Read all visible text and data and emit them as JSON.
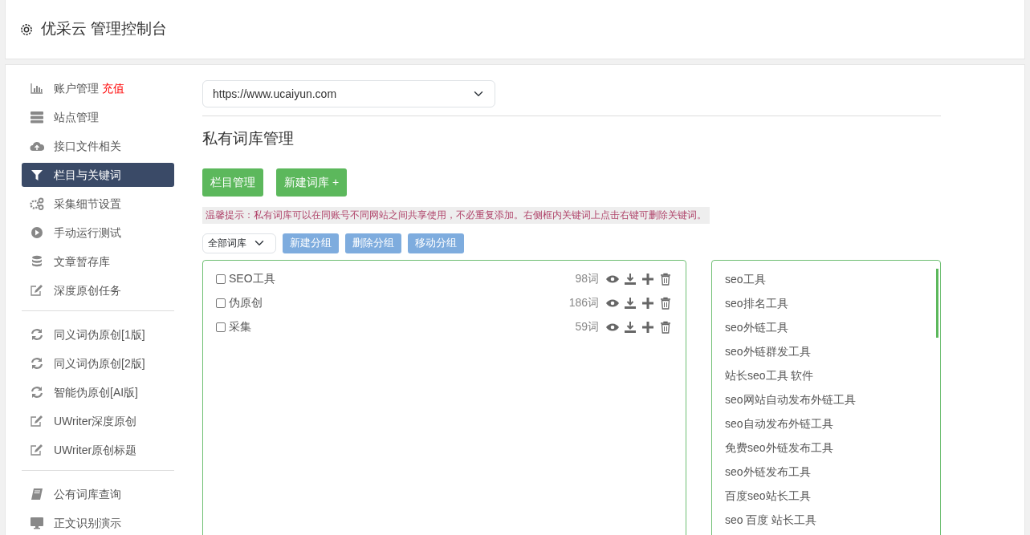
{
  "header": {
    "title": "优采云 管理控制台"
  },
  "sidebar": {
    "groups": [
      {
        "items": [
          {
            "label": "账户管理",
            "extra": "充值",
            "selected": false
          },
          {
            "label": "站点管理",
            "selected": false
          },
          {
            "label": "接口文件相关",
            "selected": false
          },
          {
            "label": "栏目与关键词",
            "selected": true
          },
          {
            "label": "采集细节设置",
            "selected": false
          },
          {
            "label": "手动运行测试",
            "selected": false
          },
          {
            "label": "文章暂存库",
            "selected": false
          },
          {
            "label": "深度原创任务",
            "selected": false
          }
        ]
      },
      {
        "items": [
          {
            "label": "同义词伪原创[1版]",
            "selected": false
          },
          {
            "label": "同义词伪原创[2版]",
            "selected": false
          },
          {
            "label": "智能伪原创[AI版]",
            "selected": false
          },
          {
            "label": "UWriter深度原创",
            "selected": false
          },
          {
            "label": "UWriter原创标题",
            "selected": false
          }
        ]
      },
      {
        "items": [
          {
            "label": "公有词库查询",
            "selected": false
          },
          {
            "label": "正文识别演示",
            "selected": false
          }
        ]
      }
    ]
  },
  "site_select": {
    "value": "https://www.ucaiyun.com"
  },
  "section_title": "私有词库管理",
  "actions": [
    "栏目管理",
    "新建词库 +"
  ],
  "tip": "温馨提示：私有词库可以在同账号不同网站之间共享使用，不必重复添加。右侧框内关键词上点击右键可删除关键词。",
  "group_select": {
    "value": "全部词库"
  },
  "group_buttons": [
    "新建分组",
    "删除分组",
    "移动分组"
  ],
  "libraries": [
    {
      "name": "SEO工具",
      "count": "98词",
      "checked": false
    },
    {
      "name": "伪原创",
      "count": "186词",
      "checked": false
    },
    {
      "name": "采集",
      "count": "59词",
      "checked": false
    }
  ],
  "keywords": [
    "seo工具",
    "seo排名工具",
    "seo外链工具",
    "seo外链群发工具",
    "站长seo工具 软件",
    "seo网站自动发布外链工具",
    "seo自动发布外链工具",
    "免费seo外链发布工具",
    "seo外链发布工具",
    "百度seo站长工具",
    "seo 百度 站长工具"
  ]
}
